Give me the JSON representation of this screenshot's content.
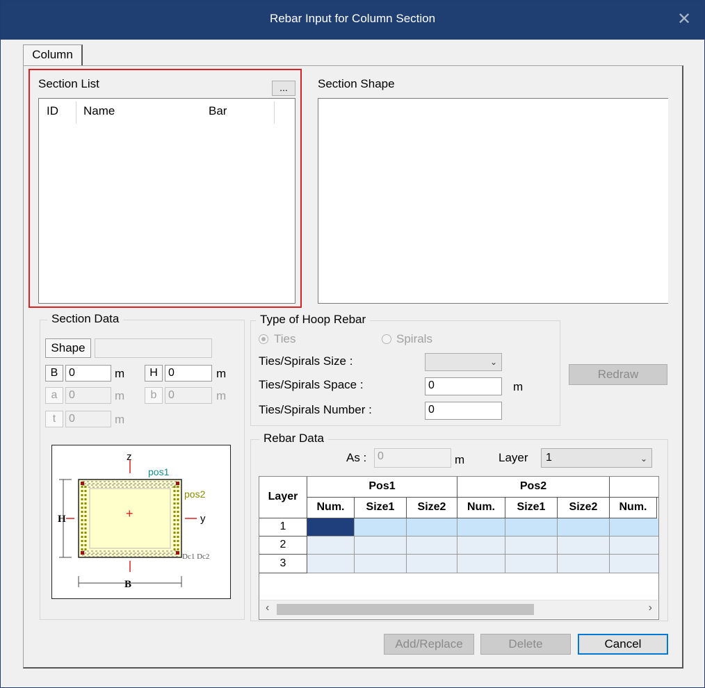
{
  "window": {
    "title": "Rebar Input for Column Section",
    "close_glyph": "✕"
  },
  "tabs": [
    {
      "label": "Column"
    }
  ],
  "section_list": {
    "title": "Section List",
    "more_label": "...",
    "columns": [
      "ID",
      "Name",
      "Bar"
    ]
  },
  "section_shape": {
    "title": "Section Shape"
  },
  "section_data": {
    "title": "Section Data",
    "shape_label": "Shape",
    "shape_value": "",
    "fields": {
      "B": {
        "label": "B",
        "value": "0",
        "unit": "m"
      },
      "H": {
        "label": "H",
        "value": "0",
        "unit": "m"
      },
      "a": {
        "label": "a",
        "value": "0",
        "unit": "m"
      },
      "b": {
        "label": "b",
        "value": "0",
        "unit": "m"
      },
      "t": {
        "label": "t",
        "value": "0",
        "unit": "m"
      }
    },
    "diagram": {
      "z": "z",
      "y": "y",
      "H": "H",
      "B": "B",
      "pos1": "pos1",
      "pos2": "pos2",
      "dc": "Dc1 Dc2",
      "colors": {
        "pos1": "#1a8a8a",
        "pos2": "#8a8a00",
        "fill": "#ffffcc",
        "axis": "#e02020"
      }
    }
  },
  "hoop": {
    "title": "Type of Hoop Rebar",
    "ties_label": "Ties",
    "spirals_label": "Spirals",
    "size_label": "Ties/Spirals Size :",
    "size_value": "",
    "space_label": "Ties/Spirals Space :",
    "space_value": "0",
    "space_unit": "m",
    "number_label": "Ties/Spirals Number :",
    "number_value": "0"
  },
  "redraw_label": "Redraw",
  "rebar_data": {
    "title": "Rebar Data",
    "as_label": "As :",
    "as_value": "0",
    "as_unit": "m",
    "layer_label": "Layer",
    "layer_value": "1",
    "table": {
      "layer_header": "Layer",
      "groups": [
        "Pos1",
        "Pos2"
      ],
      "subheaders": [
        "Num.",
        "Size1",
        "Size2",
        "Num.",
        "Size1",
        "Size2",
        "Num."
      ],
      "rows": [
        "1",
        "2",
        "3"
      ]
    },
    "colors": {
      "selected": "#1f3e7c",
      "row1": "#c8e4fb",
      "row_other": "#e6eef8"
    }
  },
  "buttons": {
    "add_replace": "Add/Replace",
    "delete": "Delete",
    "cancel": "Cancel"
  }
}
